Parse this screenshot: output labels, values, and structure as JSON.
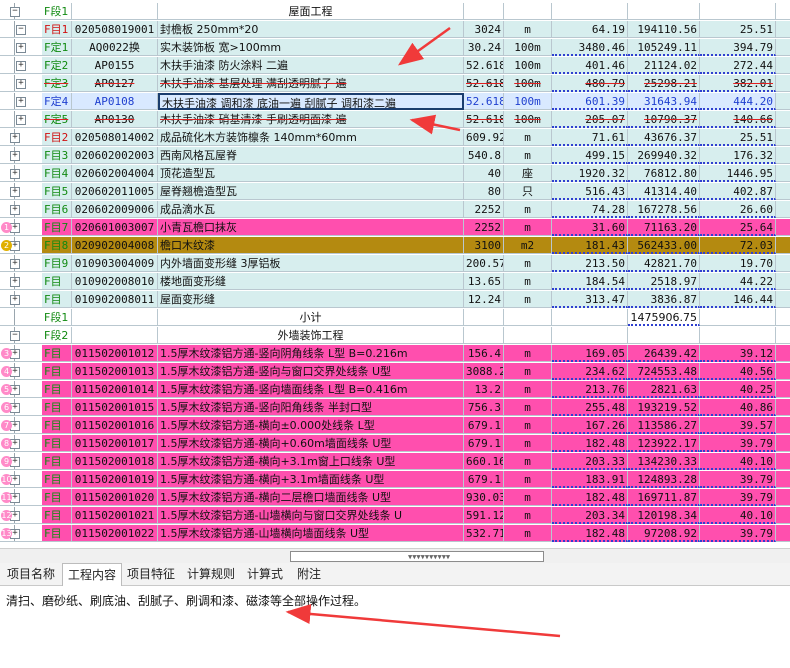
{
  "rows": [
    {
      "tree": "minus",
      "type": "F段1",
      "type_color": "green",
      "code": "",
      "name": "屋面工程",
      "qty": "",
      "unit": "",
      "up": "",
      "tot": "",
      "x": "",
      "bg": "n",
      "group": true,
      "name_center": true
    },
    {
      "tree": "minus2",
      "type": "F目1",
      "type_color": "red",
      "code": "020508019001",
      "name": "封檐板 250mm*20",
      "qty": "3024",
      "unit": "m",
      "up": "64.19",
      "tot": "194110.56",
      "x": "25.51",
      "bg": "t"
    },
    {
      "tree": "sub",
      "type": "F定1",
      "type_color": "green",
      "code": "AQ0022换",
      "name": "实木装饰板 宽>100mm",
      "qty": "30.24",
      "unit": "100m",
      "up": "3480.46",
      "tot": "105249.11",
      "x": "394.79",
      "bg": "t",
      "ul": true
    },
    {
      "tree": "sub",
      "type": "F定2",
      "type_color": "green",
      "code": "AP0155",
      "name": "木扶手油漆 防火涂料 二遍",
      "qty": "52.618",
      "unit": "100m",
      "up": "401.46",
      "tot": "21124.02",
      "x": "272.44",
      "bg": "t",
      "ul": true
    },
    {
      "tree": "sub",
      "type": "F定3",
      "type_color": "green",
      "code": "AP0127",
      "name": "木扶手油漆 基层处理 满刮透明腻子   遍",
      "qty": "52.618",
      "unit": "100m",
      "up": "480.79",
      "tot": "25298.21",
      "x": "382.01",
      "bg": "t",
      "strike": true,
      "ul": true
    },
    {
      "tree": "sub",
      "type": "F定4",
      "type_color": "blue",
      "code": "AP0108",
      "name": "木扶手油漆 调和漆 底油一遍 刮腻子 调和漆二遍",
      "qty": "52.618",
      "unit": "100m",
      "up": "601.39",
      "tot": "31643.94",
      "x": "444.20",
      "bg": "sel",
      "blue_text": true,
      "boxed": true,
      "ul": true
    },
    {
      "tree": "sub",
      "type": "F定5",
      "type_color": "green",
      "code": "AP0130",
      "name": "木扶手油漆 硝基清漆 手刷透明面漆  遍",
      "qty": "52.618",
      "unit": "100m",
      "up": "205.07",
      "tot": "10790.37",
      "x": "140.66",
      "bg": "t",
      "strike": true,
      "ul": true
    },
    {
      "tree": "plus",
      "type": "F目2",
      "type_color": "red",
      "code": "020508014002",
      "name": "成品硫化木方装饰檩条 140mm*60mm",
      "qty": "609.92",
      "unit": "m",
      "up": "71.61",
      "tot": "43676.37",
      "x": "25.51",
      "bg": "t",
      "ul": true
    },
    {
      "tree": "plus",
      "type": "F目3",
      "type_color": "green",
      "code": "020602002003",
      "name": "西南风格瓦屋脊",
      "qty": "540.8",
      "unit": "m",
      "up": "499.15",
      "tot": "269940.32",
      "x": "176.32",
      "bg": "t",
      "ul": true
    },
    {
      "tree": "plus",
      "type": "F目4",
      "type_color": "green",
      "code": "020602004004",
      "name": "顶花造型瓦",
      "qty": "40",
      "unit": "座",
      "up": "1920.32",
      "tot": "76812.80",
      "x": "1446.95",
      "bg": "t",
      "ul": true
    },
    {
      "tree": "plus",
      "type": "F目5",
      "type_color": "green",
      "code": "020602011005",
      "name": "屋脊翘檐造型瓦",
      "qty": "80",
      "unit": "只",
      "up": "516.43",
      "tot": "41314.40",
      "x": "402.87",
      "bg": "t",
      "ul": true
    },
    {
      "tree": "plus",
      "type": "F目6",
      "type_color": "green",
      "code": "020602009006",
      "name": "成品滴水瓦",
      "qty": "2252",
      "unit": "m",
      "up": "74.28",
      "tot": "167278.56",
      "x": "26.60",
      "bg": "t",
      "ul": true
    },
    {
      "tree": "plus",
      "badge": "1",
      "type": "F目7",
      "type_color": "green",
      "code": "020601003007",
      "name": "小青瓦檐口抹灰",
      "qty": "2252",
      "unit": "m",
      "up": "31.60",
      "tot": "71163.20",
      "x": "25.64",
      "bg": "p",
      "ul": true
    },
    {
      "tree": "plus",
      "badge": "2",
      "badge_gold": true,
      "type": "F目8",
      "type_color": "green",
      "code": "020902004008",
      "name": "檐口木纹漆",
      "qty": "3100",
      "unit": "m2",
      "up": "181.43",
      "tot": "562433.00",
      "x": "72.03",
      "bg": "o",
      "ul": true
    },
    {
      "tree": "plus",
      "type": "F目9",
      "type_color": "green",
      "code": "010903004009",
      "name": "内外墙面变形缝 3厚铝板",
      "qty": "200.57",
      "unit": "m",
      "up": "213.50",
      "tot": "42821.70",
      "x": "19.70",
      "bg": "t",
      "ul": true
    },
    {
      "tree": "plus",
      "type": "F目",
      "type_color": "green",
      "code": "010902008010",
      "name": "楼地面变形缝",
      "qty": "13.65",
      "unit": "m",
      "up": "184.54",
      "tot": "2518.97",
      "x": "44.22",
      "bg": "t",
      "ul": true
    },
    {
      "tree": "plus",
      "type": "F目",
      "type_color": "green",
      "code": "010902008011",
      "name": "屋面变形缝",
      "qty": "12.24",
      "unit": "m",
      "up": "313.47",
      "tot": "3836.87",
      "x": "146.44",
      "bg": "t",
      "ul": true
    },
    {
      "tree": "none",
      "type": "F段1",
      "type_color": "green",
      "code": "",
      "name": "小计",
      "qty": "",
      "unit": "",
      "up": "",
      "tot": "1475906.75",
      "x": "",
      "bg": "n",
      "group": true,
      "name_center": true,
      "tot_box": true
    },
    {
      "tree": "minus",
      "type": "F段2",
      "type_color": "green",
      "code": "",
      "name": "外墙装饰工程",
      "qty": "",
      "unit": "",
      "up": "",
      "tot": "",
      "x": "",
      "bg": "n",
      "group": true,
      "name_center": true
    },
    {
      "tree": "plus",
      "badge": "3",
      "type": "F目",
      "type_color": "green",
      "code": "011502001012",
      "name": "1.5厚木纹漆铝方通-竖向阴角线条 L型 B=0.216m",
      "qty": "156.4",
      "unit": "m",
      "up": "169.05",
      "tot": "26439.42",
      "x": "39.12",
      "bg": "p",
      "ul": true
    },
    {
      "tree": "plus",
      "badge": "4",
      "type": "F目",
      "type_color": "green",
      "code": "011502001013",
      "name": "1.5厚木纹漆铝方通-竖向与窗口交界处线条 U型",
      "qty": "3088.2",
      "unit": "m",
      "up": "234.62",
      "tot": "724553.48",
      "x": "40.56",
      "bg": "p",
      "ul": true
    },
    {
      "tree": "plus",
      "badge": "5",
      "type": "F目",
      "type_color": "green",
      "code": "011502001014",
      "name": "1.5厚木纹漆铝方通-竖向墙面线条 L型 B=0.416m",
      "qty": "13.2",
      "unit": "m",
      "up": "213.76",
      "tot": "2821.63",
      "x": "40.25",
      "bg": "p",
      "ul": true
    },
    {
      "tree": "plus",
      "badge": "6",
      "type": "F目",
      "type_color": "green",
      "code": "011502001015",
      "name": "1.5厚木纹漆铝方通-竖向阳角线条 半封口型",
      "qty": "756.3",
      "unit": "m",
      "up": "255.48",
      "tot": "193219.52",
      "x": "40.86",
      "bg": "p",
      "ul": true
    },
    {
      "tree": "plus",
      "badge": "7",
      "type": "F目",
      "type_color": "green",
      "code": "011502001016",
      "name": "1.5厚木纹漆铝方通-横向±0.000处线条 L型",
      "qty": "679.1",
      "unit": "m",
      "up": "167.26",
      "tot": "113586.27",
      "x": "39.57",
      "bg": "p",
      "ul": true
    },
    {
      "tree": "plus",
      "badge": "8",
      "type": "F目",
      "type_color": "green",
      "code": "011502001017",
      "name": "1.5厚木纹漆铝方通-横向+0.60m墙面线条 U型",
      "qty": "679.1",
      "unit": "m",
      "up": "182.48",
      "tot": "123922.17",
      "x": "39.79",
      "bg": "p",
      "ul": true
    },
    {
      "tree": "plus",
      "badge": "9",
      "type": "F目",
      "type_color": "green",
      "code": "011502001018",
      "name": "1.5厚木纹漆铝方通-横向+3.1m窗上口线条 U型",
      "qty": "660.16",
      "unit": "m",
      "up": "203.33",
      "tot": "134230.33",
      "x": "40.10",
      "bg": "p",
      "ul": true
    },
    {
      "tree": "plus",
      "badge": "10",
      "type": "F目",
      "type_color": "green",
      "code": "011502001019",
      "name": "1.5厚木纹漆铝方通-横向+3.1m墙面线条 U型",
      "qty": "679.1",
      "unit": "m",
      "up": "183.91",
      "tot": "124893.28",
      "x": "39.79",
      "bg": "p",
      "ul": true
    },
    {
      "tree": "plus",
      "badge": "11",
      "type": "F目",
      "type_color": "green",
      "code": "011502001020",
      "name": "1.5厚木纹漆铝方通-横向二层檐口墙面线条 U型",
      "qty": "930.03",
      "unit": "m",
      "up": "182.48",
      "tot": "169711.87",
      "x": "39.79",
      "bg": "p",
      "ul": true
    },
    {
      "tree": "plus",
      "badge": "12",
      "type": "F目",
      "type_color": "green",
      "code": "011502001021",
      "name": "1.5厚木纹漆铝方通-山墙横向与窗口交界处线条 U",
      "qty": "591.12",
      "unit": "m",
      "up": "203.34",
      "tot": "120198.34",
      "x": "40.10",
      "bg": "p",
      "ul": true
    },
    {
      "tree": "plus",
      "badge": "13",
      "type": "F目",
      "type_color": "green",
      "code": "011502001022",
      "name": "1.5厚木纹漆铝方通-山墙横向墙面线条 U型",
      "qty": "532.71",
      "unit": "m",
      "up": "182.48",
      "tot": "97208.92",
      "x": "39.79",
      "bg": "p",
      "ul": true
    }
  ],
  "tabs": [
    "项目名称",
    "工程内容",
    "项目特征",
    "计算规则",
    "计算式",
    "附注"
  ],
  "active_tab": 1,
  "content_text": "清扫、磨砂纸、刷底油、刮腻子、刷调和漆、磁漆等全部操作过程。",
  "colors": {
    "arrow": "#f03a3a",
    "pink": "#ff4fae",
    "gold": "#b48a10",
    "teal": "#d7eeee"
  }
}
